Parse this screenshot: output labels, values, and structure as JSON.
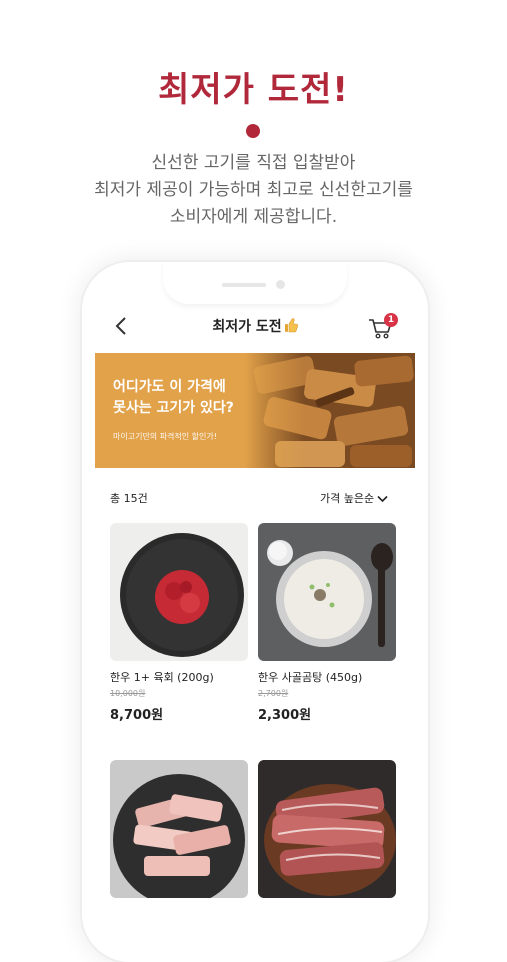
{
  "promo": {
    "headline": "최저가 도전!",
    "description": [
      "신선한 고기를 직접 입찰받아",
      "최저가 제공이 가능하며 최고로 신선한고기를",
      "소비자에게 제공합니다."
    ]
  },
  "app": {
    "title": "최저가 도전",
    "title_icon": "thumbs-up-icon",
    "cart_badge": "1",
    "banner": {
      "line1": "어디가도 이 가격에",
      "line2": "못사는 고기가 있다?",
      "subtitle": "마이고기만의 파격적인 할인가!"
    },
    "list": {
      "count": "총 15건",
      "sort": "가격 높은순"
    },
    "products": [
      {
        "name": "한우 1+ 육회 (200g)",
        "original_price": "10,000원",
        "price": "8,700원"
      },
      {
        "name": "한우 사골곰탕 (450g)",
        "original_price": "2,700원",
        "price": "2,300원"
      },
      {
        "name": "",
        "original_price": "",
        "price": ""
      },
      {
        "name": "",
        "original_price": "",
        "price": ""
      }
    ]
  },
  "colors": {
    "accent": "#b0283a",
    "badge": "#d83346",
    "banner": "#e2a24a"
  }
}
